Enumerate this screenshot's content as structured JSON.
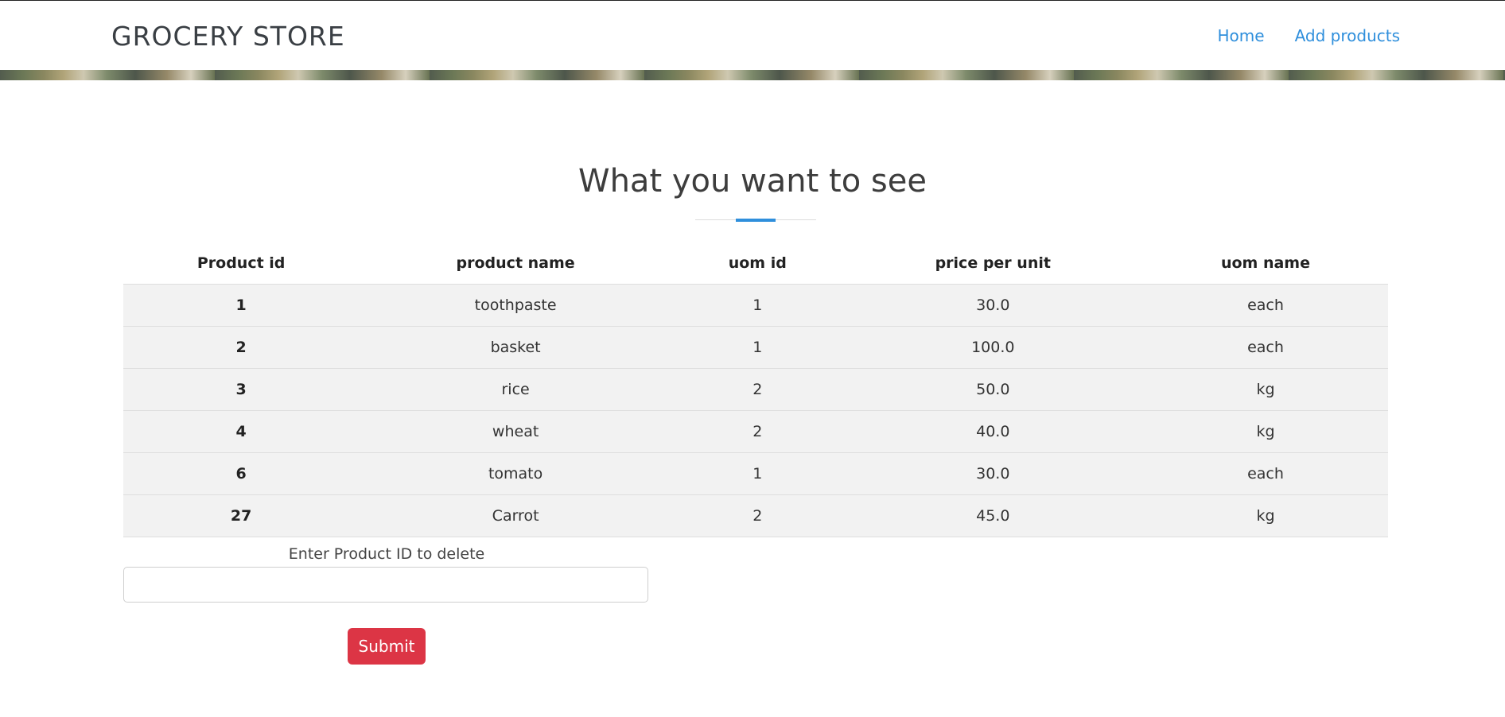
{
  "header": {
    "brand": "GROCERY STORE",
    "nav": [
      {
        "label": "Home"
      },
      {
        "label": "Add products"
      }
    ]
  },
  "main": {
    "title": "What you want to see",
    "table": {
      "columns": [
        "Product id",
        "product name",
        "uom id",
        "price per unit",
        "uom name"
      ],
      "rows": [
        [
          "1",
          "toothpaste",
          "1",
          "30.0",
          "each"
        ],
        [
          "2",
          "basket",
          "1",
          "100.0",
          "each"
        ],
        [
          "3",
          "rice",
          "2",
          "50.0",
          "kg"
        ],
        [
          "4",
          "wheat",
          "2",
          "40.0",
          "kg"
        ],
        [
          "6",
          "tomato",
          "1",
          "30.0",
          "each"
        ],
        [
          "27",
          "Carrot",
          "2",
          "45.0",
          "kg"
        ]
      ]
    },
    "delete_form": {
      "label": "Enter Product ID to delete",
      "value": "",
      "placeholder": "",
      "submit_label": "Submit"
    }
  },
  "colors": {
    "accent": "#2f8fdc",
    "danger": "#dc3545",
    "row_background": "#f2f2f2"
  }
}
